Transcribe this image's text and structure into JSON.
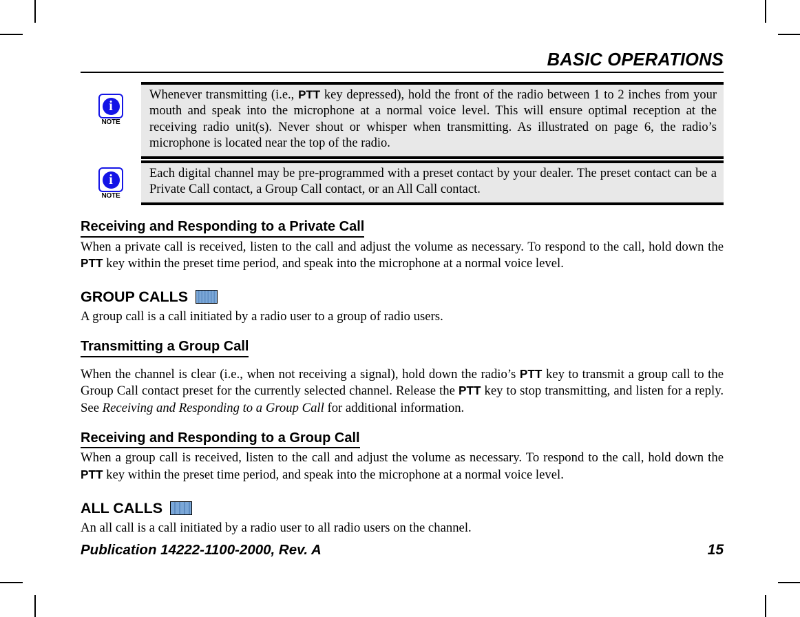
{
  "header": {
    "title": "BASIC OPERATIONS"
  },
  "notes": [
    {
      "icon_label": "NOTE",
      "icon_glyph": "i",
      "text_before_bold": "Whenever transmitting (i.e., ",
      "bold": "PTT",
      "text_after_bold": " key depressed), hold the front of the radio between 1 to 2 inches from your mouth and speak into the microphone at a normal voice level. This will ensure optimal reception at the receiving radio unit(s). Never shout or whisper when transmitting. As illustrated on page 6, the radio’s microphone is located near the top of the radio."
    },
    {
      "icon_label": "NOTE",
      "icon_glyph": "i",
      "text_before_bold": "Each digital channel may be pre-programmed with a preset contact by your dealer. The preset contact can be a Private Call contact, a Group Call contact, or an All Call contact.",
      "bold": "",
      "text_after_bold": ""
    }
  ],
  "sections": {
    "private_receive": {
      "heading": "Receiving and Responding to a Private Call",
      "p1_a": "When a private call is received, listen to the call and adjust the volume as necessary. To respond to the call, hold down the ",
      "p1_b": "PTT",
      "p1_c": " key within the preset time period, and speak into the microphone at a normal voice level."
    },
    "group_calls": {
      "heading": "GROUP CALLS",
      "icon_name": "digital-mode-icon",
      "p1": "A group call is a call initiated by a radio user to a group of radio users."
    },
    "group_transmit": {
      "heading": "Transmitting a Group Call",
      "p1_a": "When the channel is clear (i.e., when not receiving a signal), hold down the radio’s ",
      "p1_b": "PTT",
      "p1_c": " key to transmit a group call to the Group Call contact preset for the currently selected channel. Release the ",
      "p1_d": "PTT",
      "p1_e": " key to stop transmitting, and listen for a reply. See ",
      "p1_italic": "Receiving and Responding to a Group Call",
      "p1_f": " for additional information."
    },
    "group_receive": {
      "heading": "Receiving and Responding to a Group Call",
      "p1_a": "When a group call is received, listen to the call and adjust the volume as necessary.  To respond to the call, hold down the ",
      "p1_b": "PTT",
      "p1_c": " key within the preset time period, and speak into the microphone at a normal voice level."
    },
    "all_calls": {
      "heading": "ALL CALLS",
      "icon_name": "digital-mode-icon",
      "p1": "An all call is a call initiated by a radio user to all radio users on the channel."
    }
  },
  "footer": {
    "publication": "Publication 14222-1100-2000, Rev. A",
    "page_number": "15"
  },
  "colors": {
    "note_background": "#e8e8e8",
    "note_icon_blue": "#1414e6",
    "digital_icon_blue": "#7ba7d7"
  }
}
